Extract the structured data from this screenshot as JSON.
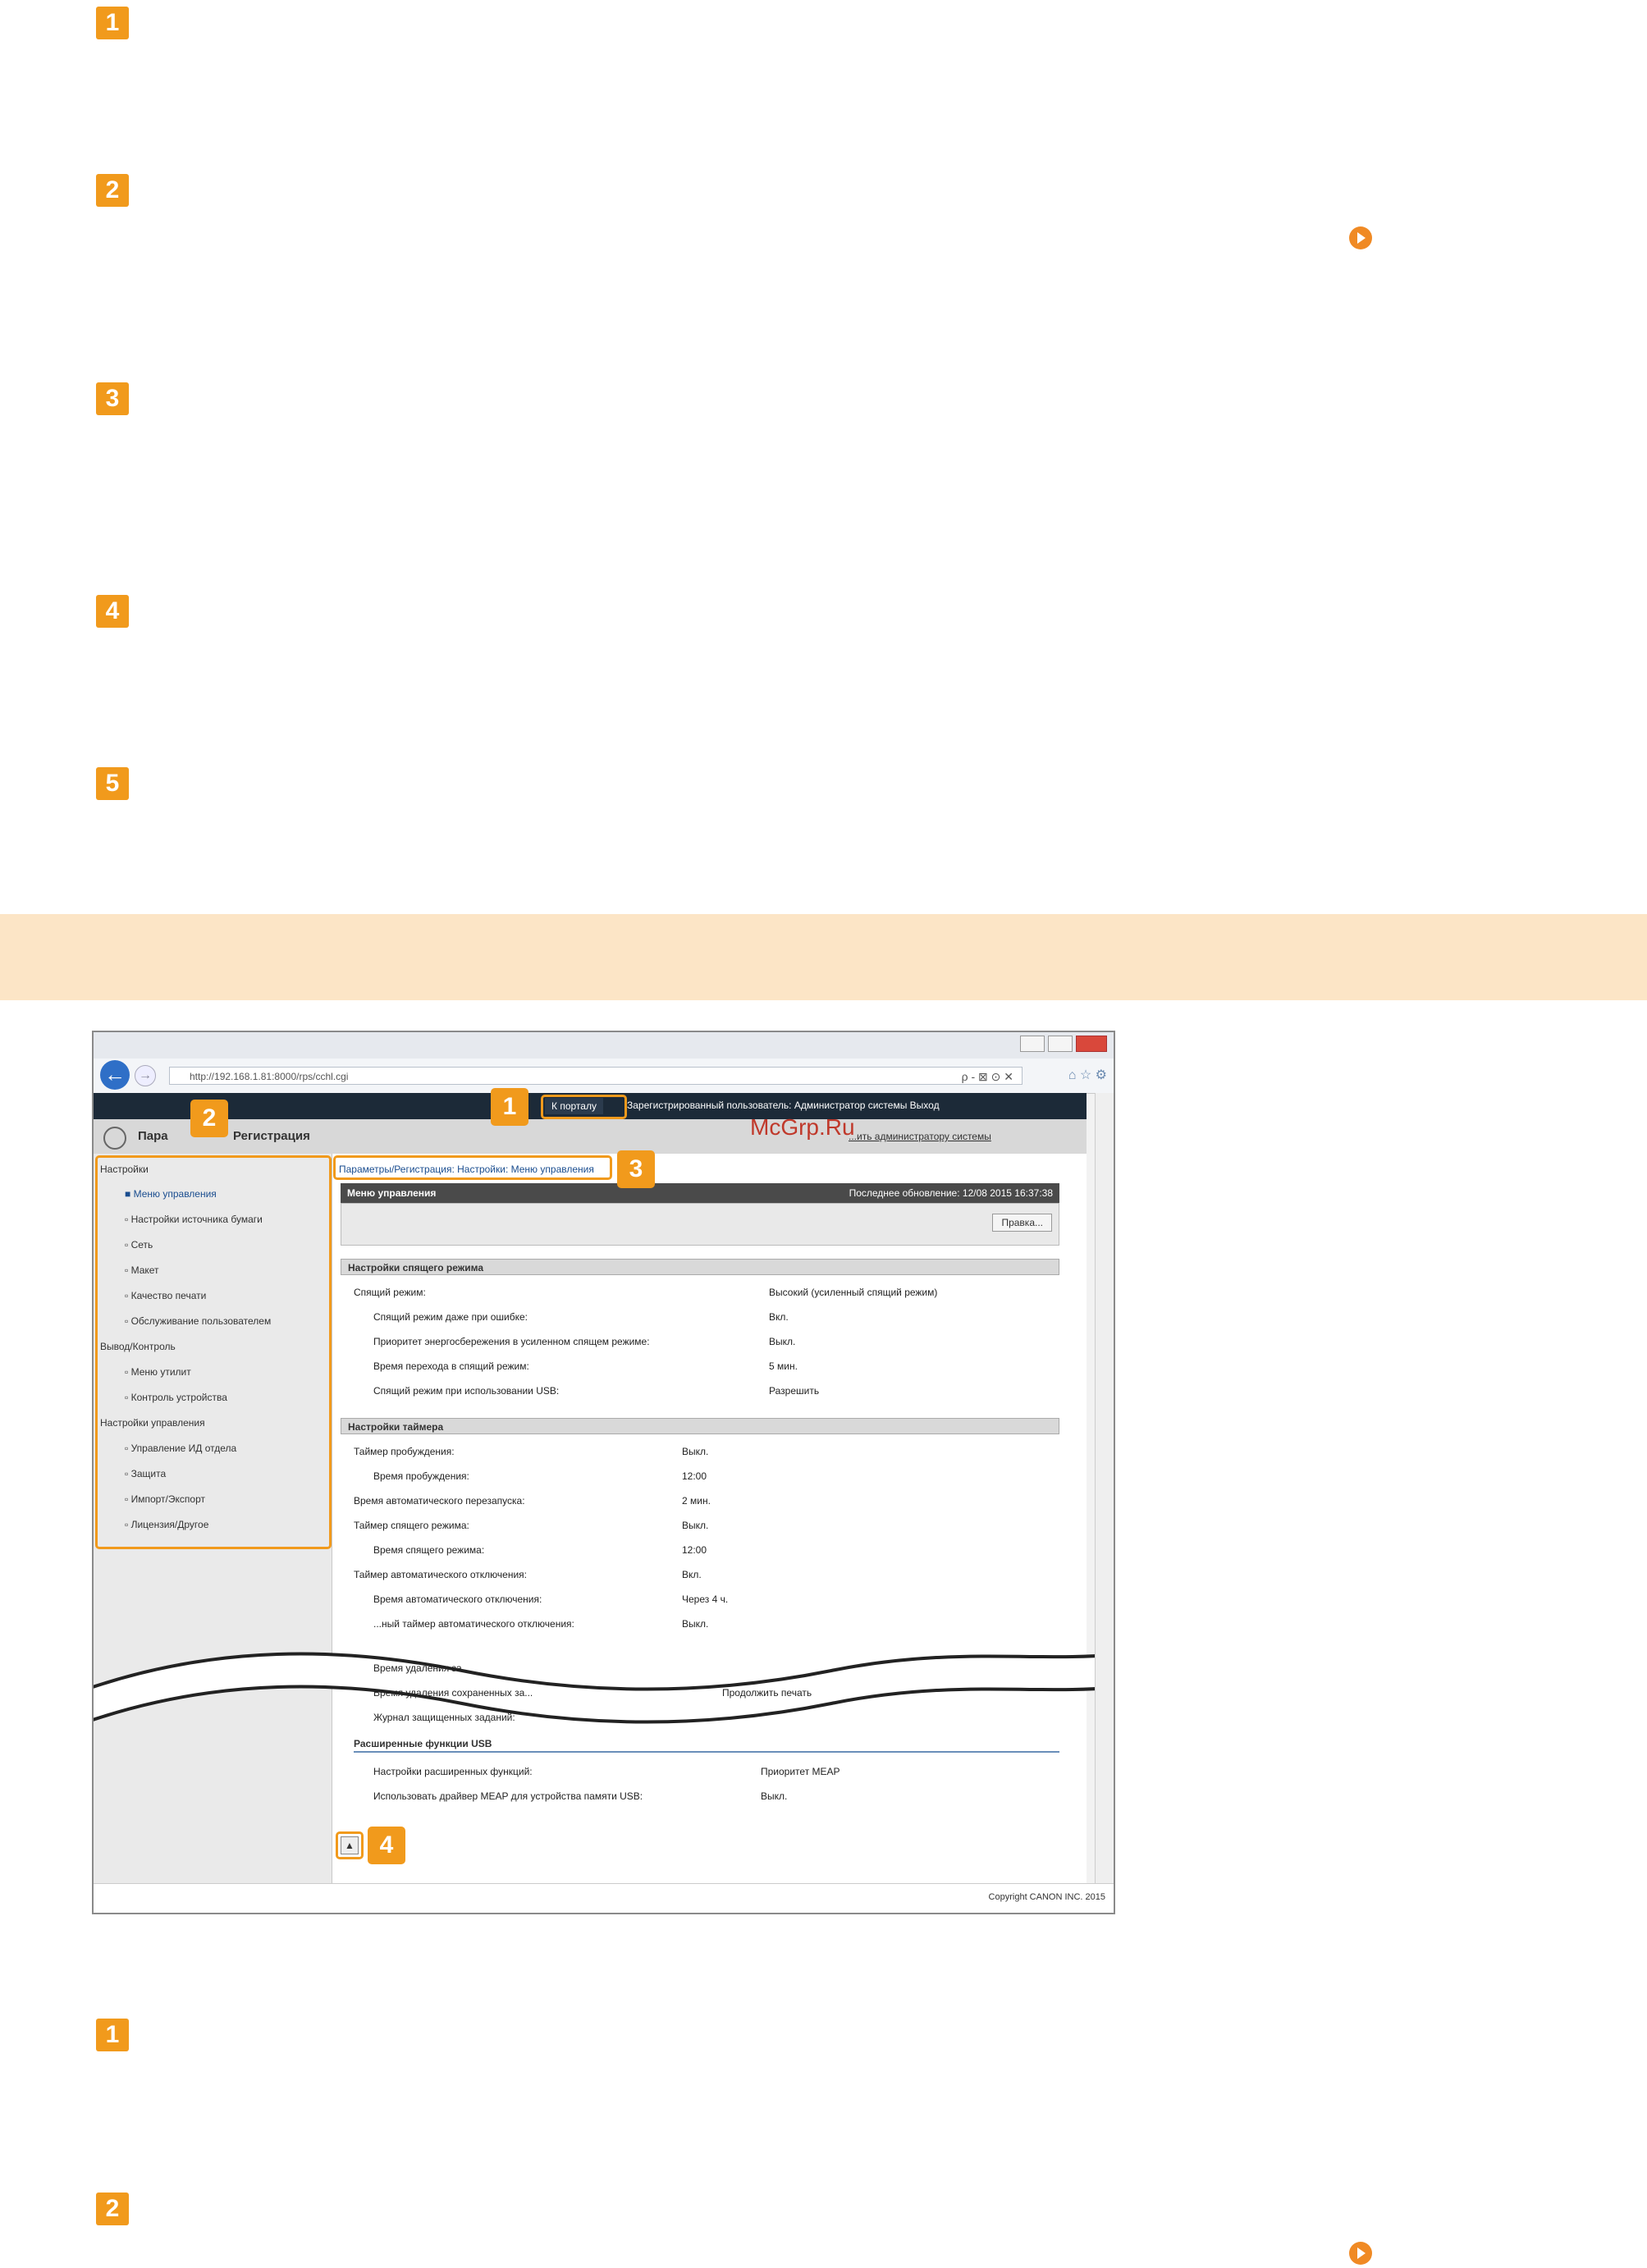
{
  "steps_top": [
    "1",
    "2",
    "3",
    "4",
    "5"
  ],
  "steps_bottom": [
    "1",
    "2"
  ],
  "browser": {
    "url": "http://192.168.1.81:8000/rps/cchl.cgi",
    "url_right": "ρ - ⊠ ⊙ ✕",
    "tab_icons": "⌂ ☆ ⚙"
  },
  "topnav": {
    "portal_label": "К порталу",
    "user_text": "Зарегистрированный пользователь: Администратор системы Выход"
  },
  "header": {
    "title_left": "Пара",
    "title_right": "Регистрация",
    "right_link": "...ить администратору системы"
  },
  "watermark": "McGrp.Ru",
  "sidebar": {
    "groups": [
      {
        "title": "Настройки",
        "items": [
          "Меню управления",
          "Настройки источника бумаги",
          "Сеть",
          "Макет",
          "Качество печати",
          "Обслуживание пользователем"
        ]
      },
      {
        "title": "Вывод/Контроль",
        "items": [
          "Меню утилит",
          "Контроль устройства"
        ]
      },
      {
        "title": "Настройки управления",
        "items": [
          "Управление ИД отдела",
          "Защита",
          "Импорт/Экспорт",
          "Лицензия/Другое"
        ]
      }
    ]
  },
  "breadcrumb": "Параметры/Регистрация: Настройки: Меню управления",
  "panel": {
    "title": "Меню управления",
    "updated": "Последнее обновление: 12/08 2015 16:37:38",
    "edit_button": "Правка..."
  },
  "sleep_section": {
    "title": "Настройки спящего режима",
    "rows": [
      {
        "label": "Спящий режим:",
        "value": "Высокий (усиленный спящий режим)"
      },
      {
        "label": "Спящий режим даже при ошибке:",
        "value": "Вкл."
      },
      {
        "label": "Приоритет энергосбережения в усиленном спящем режиме:",
        "value": "Выкл."
      },
      {
        "label": "Время перехода в спящий режим:",
        "value": "5 мин."
      },
      {
        "label": "Спящий режим при использовании USB:",
        "value": "Разрешить"
      }
    ]
  },
  "timer_section": {
    "title": "Настройки таймера",
    "rows": [
      {
        "label": "Таймер пробуждения:",
        "value": "Выкл."
      },
      {
        "label": "Время пробуждения:",
        "value": "12:00"
      },
      {
        "label": "Время автоматического перезапуска:",
        "value": "2 мин."
      },
      {
        "label": "Таймер спящего режима:",
        "value": "Выкл."
      },
      {
        "label": "Время спящего режима:",
        "value": "12:00"
      },
      {
        "label": "Таймер автоматического отключения:",
        "value": "Вкл."
      },
      {
        "label": "Время автоматического отключения:",
        "value": "Через 4 ч."
      },
      {
        "label": "...ный таймер автоматического отключения:",
        "value": "Выкл."
      }
    ]
  },
  "tail_rows": [
    {
      "label": "Время удаления за...",
      "value": ""
    },
    {
      "label": "Время удаления сохраненных за...",
      "value": "Продолжить печать"
    },
    {
      "label": "Журнал защищенных заданий:",
      "value": ""
    }
  ],
  "usb_section": {
    "title": "Расширенные функции USB",
    "rows": [
      {
        "label": "Настройки расширенных функций:",
        "value": "Приоритет MEAP"
      },
      {
        "label": "Использовать драйвер MEAP для устройства памяти USB:",
        "value": "Выкл."
      }
    ]
  },
  "footer": "Copyright CANON INC. 2015",
  "callouts": [
    "1",
    "2",
    "3",
    "4"
  ]
}
